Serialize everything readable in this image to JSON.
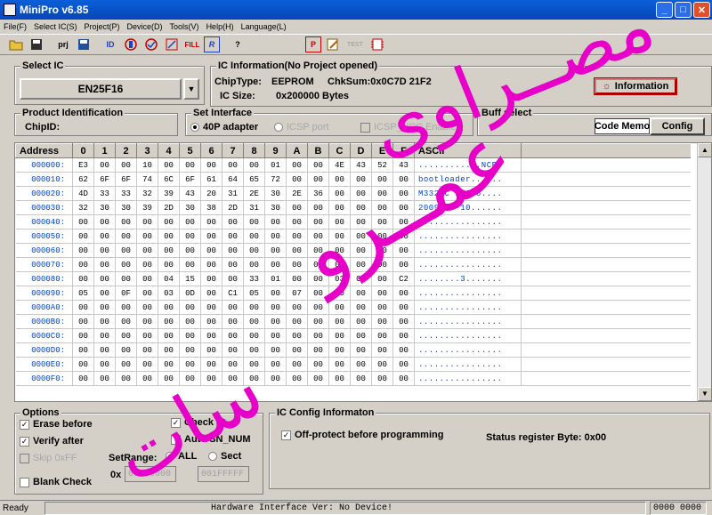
{
  "window": {
    "title": "MiniPro v6.85",
    "min": "_",
    "max": "□",
    "close": "✕"
  },
  "menu": [
    "File(F)",
    "Select IC(S)",
    "Project(P)",
    "Device(D)",
    "Tools(V)",
    "Help(H)",
    "Language(L)"
  ],
  "toolbar": {
    "icons": [
      "open-icon",
      "save-icon",
      "project-icon",
      "save-project-icon",
      "id-icon",
      "blank-icon",
      "verify-icon",
      "erase-icon",
      "fill-icon",
      "read-icon",
      "help-icon",
      "program-icon",
      "edit-icon",
      "test-icon",
      "chip-icon"
    ],
    "labels": {
      "prj": "prj",
      "id": "ID",
      "fill": "FILL",
      "r": "R",
      "help": "?",
      "p": "P",
      "test": "TEST"
    }
  },
  "select_ic": {
    "legend": "Select IC",
    "value": "EN25F16",
    "dropdown": "▼"
  },
  "ic_info": {
    "legend": "IC Information(No Project opened)",
    "chip_type_label": "ChipType:",
    "chip_type": "EEPROM",
    "chksum": "ChkSum:0x0C7D 21F2",
    "ic_size_label": "IC Size:",
    "ic_size": "0x200000 Bytes",
    "info_button": "Information",
    "info_icon": "☼"
  },
  "product_id": {
    "legend": "Product Identification",
    "chip_id_label": "ChipID:"
  },
  "interface": {
    "legend": "Set Interface",
    "opt1": "40P adapter",
    "opt2": "ICSP port",
    "opt3": "ICSP_VCC Enable"
  },
  "buf_select": {
    "legend": "Buff select",
    "code_memo": "Code Memo",
    "config": "Config"
  },
  "hex": {
    "address_header": "Address",
    "columns": [
      "0",
      "1",
      "2",
      "3",
      "4",
      "5",
      "6",
      "7",
      "8",
      "9",
      "A",
      "B",
      "C",
      "D",
      "E",
      "F"
    ],
    "ascii_header": "ASCII",
    "rows": [
      {
        "addr": "000000:",
        "bytes": [
          "E3",
          "00",
          "00",
          "10",
          "00",
          "00",
          "00",
          "00",
          "00",
          "01",
          "00",
          "00",
          "4E",
          "43",
          "52",
          "43"
        ],
        "ascii": "............NCRC"
      },
      {
        "addr": "000010:",
        "bytes": [
          "62",
          "6F",
          "6F",
          "74",
          "6C",
          "6F",
          "61",
          "64",
          "65",
          "72",
          "00",
          "00",
          "00",
          "00",
          "00",
          "00"
        ],
        "ascii": "bootloader......"
      },
      {
        "addr": "000020:",
        "bytes": [
          "4D",
          "33",
          "33",
          "32",
          "39",
          "43",
          "20",
          "31",
          "2E",
          "30",
          "2E",
          "36",
          "00",
          "00",
          "00",
          "00"
        ],
        "ascii": "M3329C 1.0.6...."
      },
      {
        "addr": "000030:",
        "bytes": [
          "32",
          "30",
          "30",
          "39",
          "2D",
          "30",
          "38",
          "2D",
          "31",
          "30",
          "00",
          "00",
          "00",
          "00",
          "00",
          "00"
        ],
        "ascii": "2009-08-10......"
      },
      {
        "addr": "000040:",
        "bytes": [
          "00",
          "00",
          "00",
          "00",
          "00",
          "00",
          "00",
          "00",
          "00",
          "00",
          "00",
          "00",
          "00",
          "00",
          "00",
          "00"
        ],
        "ascii": "................"
      },
      {
        "addr": "000050:",
        "bytes": [
          "00",
          "00",
          "00",
          "00",
          "00",
          "00",
          "00",
          "00",
          "00",
          "00",
          "00",
          "00",
          "00",
          "00",
          "00",
          "00"
        ],
        "ascii": "................"
      },
      {
        "addr": "000060:",
        "bytes": [
          "00",
          "00",
          "00",
          "00",
          "00",
          "00",
          "00",
          "00",
          "00",
          "00",
          "00",
          "00",
          "00",
          "00",
          "00",
          "00"
        ],
        "ascii": "................"
      },
      {
        "addr": "000070:",
        "bytes": [
          "00",
          "00",
          "00",
          "00",
          "00",
          "00",
          "00",
          "00",
          "00",
          "00",
          "00",
          "00",
          "00",
          "00",
          "00",
          "00"
        ],
        "ascii": "................"
      },
      {
        "addr": "000080:",
        "bytes": [
          "00",
          "00",
          "00",
          "00",
          "04",
          "15",
          "00",
          "00",
          "33",
          "01",
          "00",
          "00",
          "03",
          "0D",
          "00",
          "C2"
        ],
        "ascii": "........3......."
      },
      {
        "addr": "000090:",
        "bytes": [
          "05",
          "00",
          "0F",
          "00",
          "03",
          "0D",
          "00",
          "C1",
          "05",
          "00",
          "07",
          "00",
          "00",
          "00",
          "00",
          "00"
        ],
        "ascii": "................"
      },
      {
        "addr": "0000A0:",
        "bytes": [
          "00",
          "00",
          "00",
          "00",
          "00",
          "00",
          "00",
          "00",
          "00",
          "00",
          "00",
          "00",
          "00",
          "00",
          "00",
          "00"
        ],
        "ascii": "................"
      },
      {
        "addr": "0000B0:",
        "bytes": [
          "00",
          "00",
          "00",
          "00",
          "00",
          "00",
          "00",
          "00",
          "00",
          "00",
          "00",
          "00",
          "00",
          "00",
          "00",
          "00"
        ],
        "ascii": "................"
      },
      {
        "addr": "0000C0:",
        "bytes": [
          "00",
          "00",
          "00",
          "00",
          "00",
          "00",
          "00",
          "00",
          "00",
          "00",
          "00",
          "00",
          "00",
          "00",
          "00",
          "00"
        ],
        "ascii": "................"
      },
      {
        "addr": "0000D0:",
        "bytes": [
          "00",
          "00",
          "00",
          "00",
          "00",
          "00",
          "00",
          "00",
          "00",
          "00",
          "00",
          "00",
          "00",
          "00",
          "00",
          "00"
        ],
        "ascii": "................"
      },
      {
        "addr": "0000E0:",
        "bytes": [
          "00",
          "00",
          "00",
          "00",
          "00",
          "00",
          "00",
          "00",
          "00",
          "00",
          "00",
          "00",
          "00",
          "00",
          "00",
          "00"
        ],
        "ascii": "................"
      },
      {
        "addr": "0000F0:",
        "bytes": [
          "00",
          "00",
          "00",
          "00",
          "00",
          "00",
          "00",
          "00",
          "00",
          "00",
          "00",
          "00",
          "00",
          "00",
          "00",
          "00"
        ],
        "ascii": "................"
      }
    ]
  },
  "options": {
    "legend": "Options",
    "erase_before": "Erase before",
    "verify_after": "Verify after",
    "skip_0xff": "Skip 0xFF",
    "blank_check": "Blank Check",
    "check_id": "Check ID",
    "auto_sn": "Auto SN_NUM",
    "set_range": "SetRange:",
    "all": "ALL",
    "sect": "Sect",
    "ox": "0x",
    "range_from": "00000000",
    "range_to": "001FFFFF"
  },
  "ic_config": {
    "legend": "IC Config Informaton",
    "off_protect": "Off-protect before programming",
    "status_register": "Status register Byte: 0x00"
  },
  "status": {
    "ready": "Ready",
    "hardware": "Hardware Interface Ver: No Device!",
    "code": "0000 0000"
  },
  "watermark": {
    "line1": "مصــراوى",
    "line2": "عمــرو",
    "line3": "سات",
    "color": "#e600c8"
  }
}
